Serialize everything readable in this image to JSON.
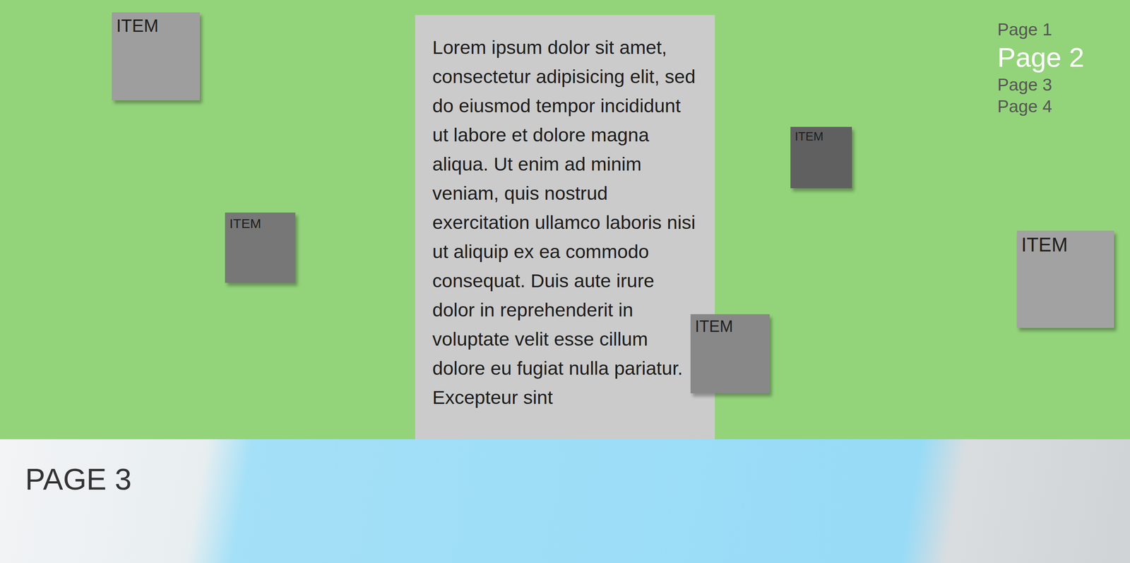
{
  "nav": [
    {
      "label": "Page 1",
      "selected": false
    },
    {
      "label": "Page 2",
      "selected": true
    },
    {
      "label": "Page 3",
      "selected": false
    },
    {
      "label": "Page 4",
      "selected": false
    }
  ],
  "content": {
    "text": "Lorem ipsum dolor sit amet, consectetur adipisicing elit, sed do eiusmod tempor incididunt ut labore et dolore magna aliqua. Ut enim ad minim veniam, quis nostrud exercitation ullamco laboris nisi ut aliquip ex ea commodo consequat. Duis aute irure dolor in reprehenderit in voluptate velit esse cillum dolore eu fugiat nulla pariatur. Excepteur sint"
  },
  "items": [
    {
      "label": "ITEM",
      "color": "#9e9e9e"
    },
    {
      "label": "ITEM",
      "color": "#777777"
    },
    {
      "label": "ITEM",
      "color": "#606060"
    },
    {
      "label": "ITEM",
      "color": "#a2a2a2"
    },
    {
      "label": "ITEM",
      "color": "#888888"
    }
  ],
  "next_section": {
    "heading": "PAGE 3"
  }
}
